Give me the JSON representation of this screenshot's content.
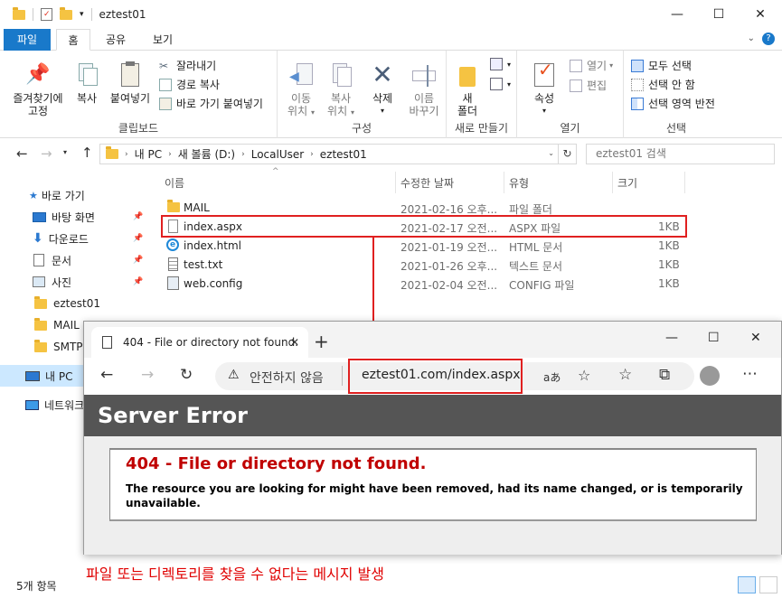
{
  "explorer": {
    "title": "eztest01",
    "window_controls": {
      "minimize": "—",
      "maximize": "☐",
      "close": "✕"
    },
    "tabs": [
      "파일",
      "홈",
      "공유",
      "보기"
    ],
    "ribbon": {
      "clipboard": {
        "pin_label_1": "즐겨찾기에",
        "pin_label_2": "고정",
        "copy": "복사",
        "paste": "붙여넣기",
        "cut": "잘라내기",
        "copy_path": "경로 복사",
        "paste_shortcut": "바로 가기 붙여넣기",
        "group": "클립보드"
      },
      "organize": {
        "move_1": "이동",
        "move_2": "위치",
        "copy_1": "복사",
        "copy_2": "위치",
        "delete": "삭제",
        "rename_1": "이름",
        "rename_2": "바꾸기",
        "group": "구성"
      },
      "new": {
        "new_folder_1": "새",
        "new_folder_2": "폴더",
        "group": "새로 만들기"
      },
      "open": {
        "properties": "속성",
        "open": "열기",
        "edit": "편집",
        "group": "열기"
      },
      "select": {
        "select_all": "모두 선택",
        "select_none": "선택 안 함",
        "invert": "선택 영역 반전",
        "group": "선택"
      }
    },
    "address": {
      "path": [
        "내 PC",
        "새 볼륨 (D:)",
        "LocalUser",
        "eztest01"
      ],
      "search_placeholder": "eztest01 검색"
    },
    "nav": {
      "quick_access": "바로 가기",
      "items": [
        "바탕 화면",
        "다운로드",
        "문서",
        "사진",
        "eztest01",
        "MAIL",
        "SMTPS"
      ],
      "this_pc": "내 PC",
      "network": "네트워크"
    },
    "columns": {
      "name": "이름",
      "date": "수정한 날짜",
      "type": "유형",
      "size": "크기"
    },
    "files": [
      {
        "name": "MAIL",
        "date": "2021-02-16 오후...",
        "type": "파일 폴더",
        "size": "",
        "icon": "folder-icon"
      },
      {
        "name": "index.aspx",
        "date": "2021-02-17 오전...",
        "type": "ASPX 파일",
        "size": "1KB",
        "icon": "file-icon"
      },
      {
        "name": "index.html",
        "date": "2021-01-19 오전...",
        "type": "HTML 문서",
        "size": "1KB",
        "icon": "edge-icon"
      },
      {
        "name": "test.txt",
        "date": "2021-01-26 오후...",
        "type": "텍스트 문서",
        "size": "1KB",
        "icon": "text-file-icon"
      },
      {
        "name": "web.config",
        "date": "2021-02-04 오전...",
        "type": "CONFIG 파일",
        "size": "1KB",
        "icon": "config-file-icon"
      }
    ],
    "status": "5개 항목"
  },
  "browser": {
    "tab_title": "404 - File or directory not found.",
    "new_tab": "+",
    "security_label": "안전하지 않음",
    "url": "eztest01.com/index.aspx",
    "read_aloud": "aあ",
    "error_header": "Server Error",
    "error_title": "404 - File or directory not found.",
    "error_message": "The resource you are looking for might have been removed, had its name changed, or is temporarily unavailable."
  },
  "annotation": {
    "caption": "파일 또는 디렉토리를 찾을 수 없다는 메시지 발생",
    "color": "#e02020"
  },
  "colors": {
    "file_tab": "#1979ca",
    "error_header_bg": "#555555",
    "error_title": "#c00000"
  }
}
